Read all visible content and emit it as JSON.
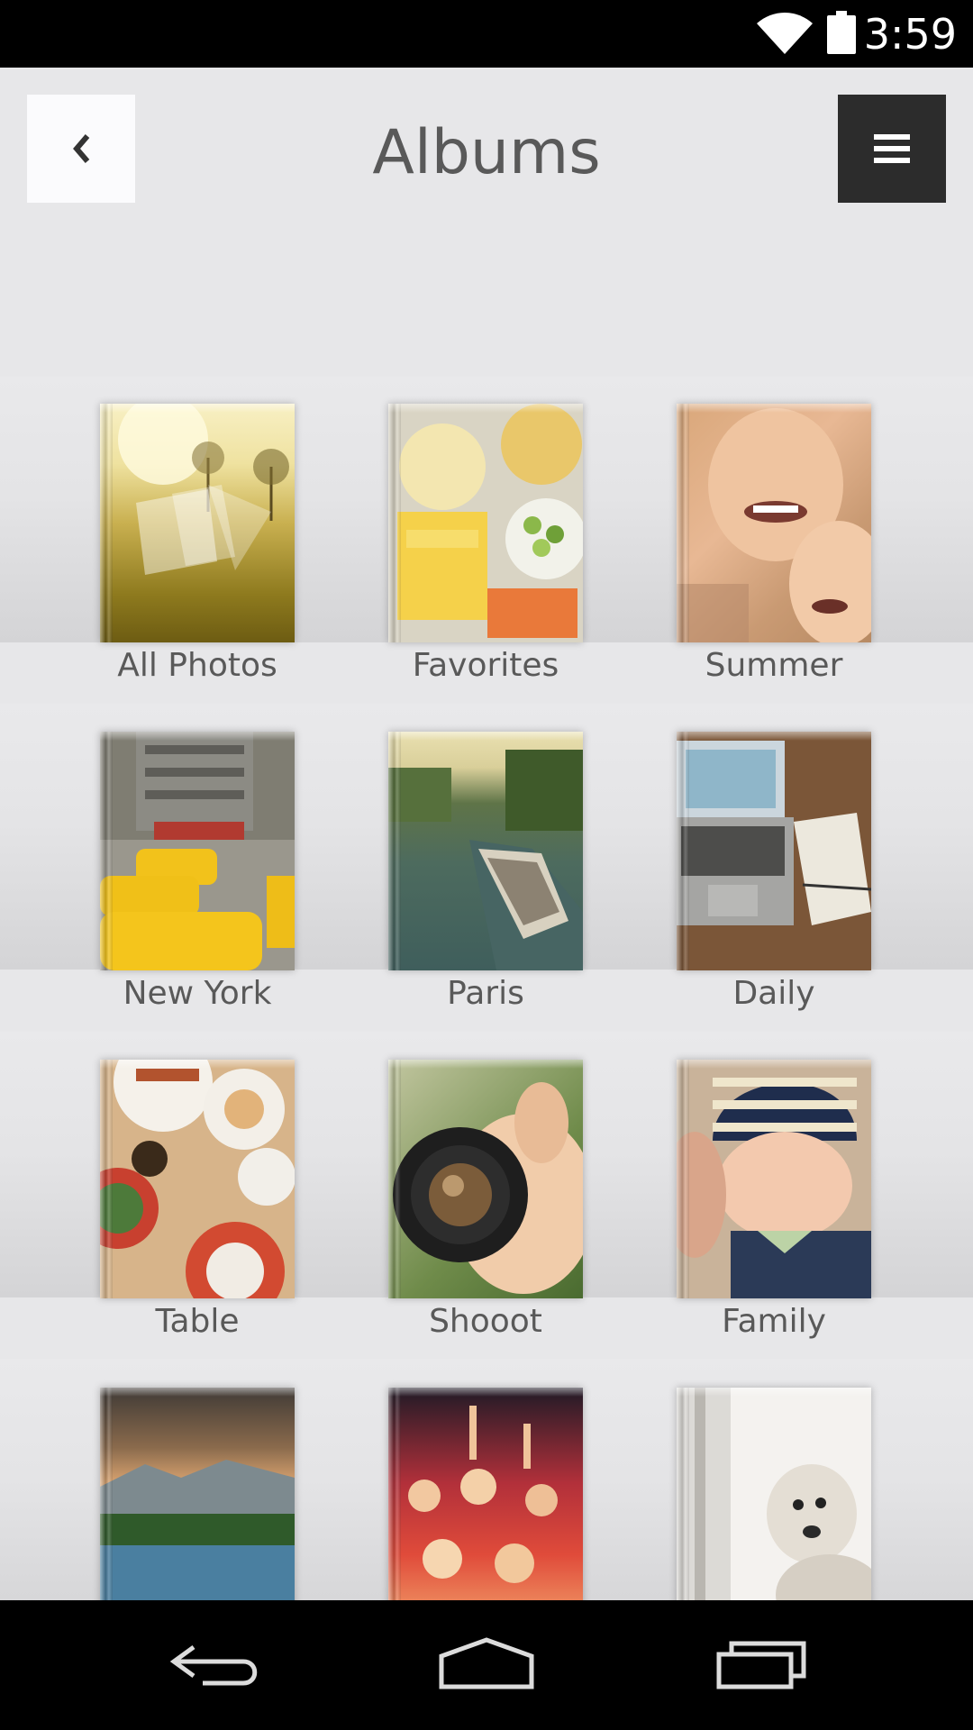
{
  "status_bar": {
    "time": "3:59",
    "wifi_icon": "wifi-icon",
    "battery_icon": "battery-icon"
  },
  "header": {
    "title": "Albums",
    "back_icon": "chevron-left-icon",
    "menu_icon": "hamburger-menu-icon"
  },
  "albums": [
    {
      "label": "All Photos",
      "cover": "golden meadow with trees and photo-stack logo"
    },
    {
      "label": "Favorites",
      "cover": "cheese and fruit platter"
    },
    {
      "label": "Summer",
      "cover": "smiling children"
    },
    {
      "label": "New York",
      "cover": "yellow taxis on a city street"
    },
    {
      "label": "Paris",
      "cover": "tour boat on a river"
    },
    {
      "label": "Daily",
      "cover": "laptop and notebook on desk"
    },
    {
      "label": "Table",
      "cover": "breakfast plates on a table"
    },
    {
      "label": "Shooot",
      "cover": "hands holding a camera lens"
    },
    {
      "label": "Family",
      "cover": "baby in striped hat"
    },
    {
      "label": "",
      "cover": "mountain lake landscape"
    },
    {
      "label": "",
      "cover": "concert crowd"
    },
    {
      "label": "",
      "cover": "dog by a window"
    }
  ],
  "nav_bar": {
    "back_icon": "back-arrow-icon",
    "home_icon": "home-icon",
    "recents_icon": "recent-apps-icon"
  }
}
